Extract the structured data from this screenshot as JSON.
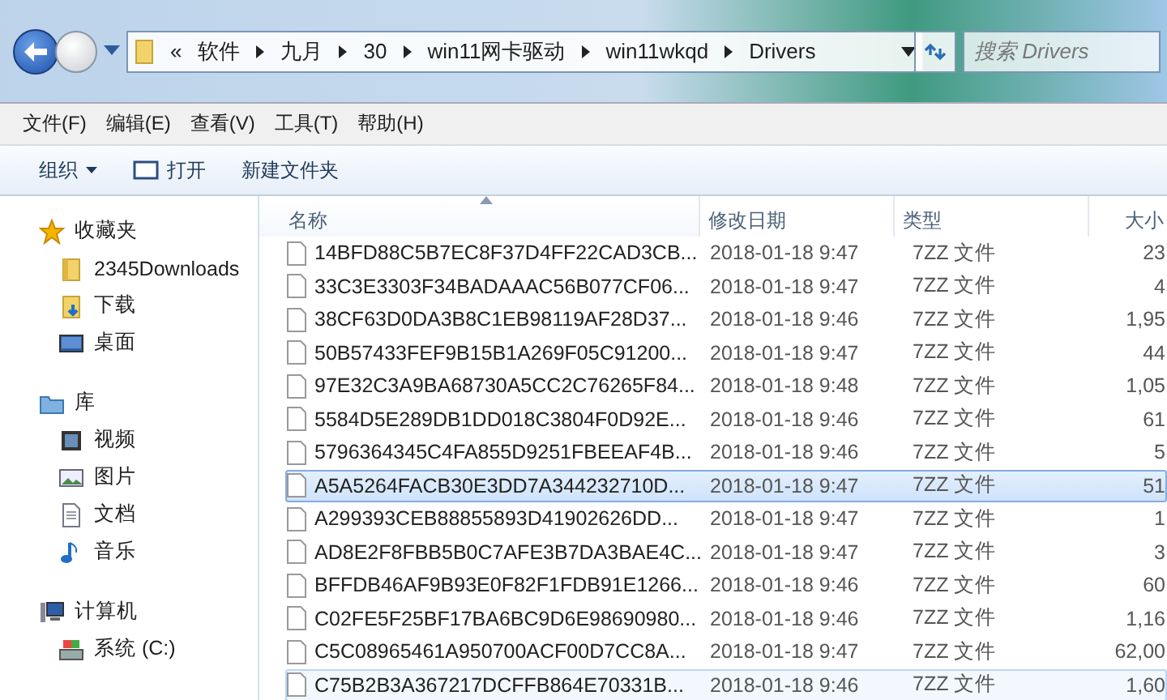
{
  "nav": {
    "overflow_mark": "«",
    "breadcrumb": [
      "软件",
      "九月",
      "30",
      "win11网卡驱动",
      "win11wkqd",
      "Drivers"
    ],
    "search": {
      "placeholder": "搜索 Drivers"
    }
  },
  "menu": [
    "文件(F)",
    "编辑(E)",
    "查看(V)",
    "工具(T)",
    "帮助(H)"
  ],
  "toolbar": [
    {
      "label": "组织",
      "kind": "dropdown"
    },
    {
      "label": "打开",
      "kind": "open"
    },
    {
      "label": "新建文件夹",
      "kind": "plain"
    }
  ],
  "sidebar": [
    {
      "label": "收藏夹",
      "kind": "star",
      "children": [
        {
          "label": "2345Downloads",
          "kind": "folder"
        },
        {
          "label": "下载",
          "kind": "download"
        },
        {
          "label": "桌面",
          "kind": "desktop"
        }
      ]
    },
    {
      "label": "库",
      "kind": "library",
      "children": [
        {
          "label": "视频",
          "kind": "video"
        },
        {
          "label": "图片",
          "kind": "picture"
        },
        {
          "label": "文档",
          "kind": "document"
        },
        {
          "label": "音乐",
          "kind": "music"
        }
      ]
    },
    {
      "label": "计算机",
      "kind": "computer",
      "children": [
        {
          "label": "系统 (C:)",
          "kind": "drive"
        }
      ]
    }
  ],
  "table": {
    "columns": [
      {
        "label": "名称",
        "sorted": true
      },
      {
        "label": "修改日期",
        "sorted": false
      },
      {
        "label": "类型",
        "sorted": false
      },
      {
        "label": "大小",
        "sorted": false
      }
    ],
    "rows": [
      {
        "name": "14BFD88C5B7EC8F37D4FF22CAD3CB...",
        "date": "2018-01-18 9:47",
        "type": "7ZZ 文件",
        "size": "23",
        "selected": false,
        "hovered": false
      },
      {
        "name": "33C3E3303F34BADAAAC56B077CF06...",
        "date": "2018-01-18 9:47",
        "type": "7ZZ 文件",
        "size": "4",
        "selected": false,
        "hovered": false
      },
      {
        "name": "38CF63D0DA3B8C1EB98119AF28D37...",
        "date": "2018-01-18 9:46",
        "type": "7ZZ 文件",
        "size": "1,95",
        "selected": false,
        "hovered": false
      },
      {
        "name": "50B57433FEF9B15B1A269F05C91200...",
        "date": "2018-01-18 9:47",
        "type": "7ZZ 文件",
        "size": "44",
        "selected": false,
        "hovered": false
      },
      {
        "name": "97E32C3A9BA68730A5CC2C76265F84...",
        "date": "2018-01-18 9:48",
        "type": "7ZZ 文件",
        "size": "1,05",
        "selected": false,
        "hovered": false
      },
      {
        "name": "5584D5E289DB1DD018C3804F0D92E...",
        "date": "2018-01-18 9:46",
        "type": "7ZZ 文件",
        "size": "61",
        "selected": false,
        "hovered": false
      },
      {
        "name": "5796364345C4FA855D9251FBEEAF4B...",
        "date": "2018-01-18 9:46",
        "type": "7ZZ 文件",
        "size": "5",
        "selected": false,
        "hovered": false
      },
      {
        "name": "A5A5264FACB30E3DD7A344232710D...",
        "date": "2018-01-18 9:47",
        "type": "7ZZ 文件",
        "size": "51",
        "selected": true,
        "hovered": false
      },
      {
        "name": "A299393CEB88855893D41902626DD...",
        "date": "2018-01-18 9:47",
        "type": "7ZZ 文件",
        "size": "1",
        "selected": false,
        "hovered": false
      },
      {
        "name": "AD8E2F8FBB5B0C7AFE3B7DA3BAE4C...",
        "date": "2018-01-18 9:47",
        "type": "7ZZ 文件",
        "size": "3",
        "selected": false,
        "hovered": false
      },
      {
        "name": "BFFDB46AF9B93E0F82F1FDB91E1266...",
        "date": "2018-01-18 9:46",
        "type": "7ZZ 文件",
        "size": "60",
        "selected": false,
        "hovered": false
      },
      {
        "name": "C02FE5F25BF17BA6BC9D6E98690980...",
        "date": "2018-01-18 9:46",
        "type": "7ZZ 文件",
        "size": "1,16",
        "selected": false,
        "hovered": false
      },
      {
        "name": "C5C08965461A950700ACF00D7CC8A...",
        "date": "2018-01-18 9:47",
        "type": "7ZZ 文件",
        "size": "62,00",
        "selected": false,
        "hovered": false
      },
      {
        "name": "C75B2B3A367217DCFFB864E70331B...",
        "date": "2018-01-18 9:46",
        "type": "7ZZ 文件",
        "size": "1,60",
        "selected": false,
        "hovered": true
      }
    ]
  }
}
